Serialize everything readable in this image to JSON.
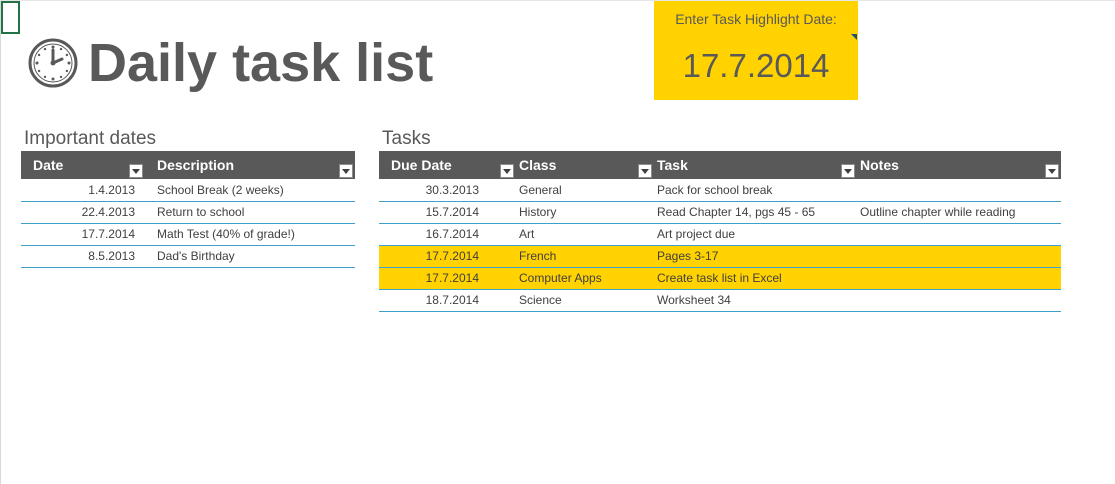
{
  "title": "Daily task list",
  "highlight": {
    "label": "Enter Task Highlight Date:",
    "date": "17.7.2014",
    "color": "#ffd200"
  },
  "important_dates": {
    "heading": "Important dates",
    "columns": [
      "Date",
      "Description"
    ],
    "rows": [
      {
        "date": "1.4.2013",
        "description": "School Break (2 weeks)"
      },
      {
        "date": "22.4.2013",
        "description": "Return to school"
      },
      {
        "date": "17.7.2014",
        "description": "Math Test (40% of grade!)"
      },
      {
        "date": "8.5.2013",
        "description": "Dad's Birthday"
      }
    ]
  },
  "tasks": {
    "heading": "Tasks",
    "columns": [
      "Due Date",
      "Class",
      "Task",
      "Notes"
    ],
    "rows": [
      {
        "due": "30.3.2013",
        "class": "General",
        "task": "Pack for school break",
        "notes": "",
        "highlighted": false
      },
      {
        "due": "15.7.2014",
        "class": "History",
        "task": "Read Chapter 14, pgs 45 - 65",
        "notes": "Outline chapter while reading",
        "highlighted": false
      },
      {
        "due": "16.7.2014",
        "class": "Art",
        "task": "Art project due",
        "notes": "",
        "highlighted": false
      },
      {
        "due": "17.7.2014",
        "class": "French",
        "task": "Pages 3-17",
        "notes": "",
        "highlighted": true
      },
      {
        "due": "17.7.2014",
        "class": "Computer Apps",
        "task": "Create task list in Excel",
        "notes": "",
        "highlighted": true
      },
      {
        "due": "18.7.2014",
        "class": "Science",
        "task": "Worksheet 34",
        "notes": "",
        "highlighted": false
      }
    ]
  },
  "icons": {
    "clock": "clock-icon",
    "filter": "filter-dropdown-icon"
  },
  "colors": {
    "header_bg": "#595959",
    "row_border": "#41a0c8",
    "highlight": "#ffd200",
    "text": "#404040"
  }
}
